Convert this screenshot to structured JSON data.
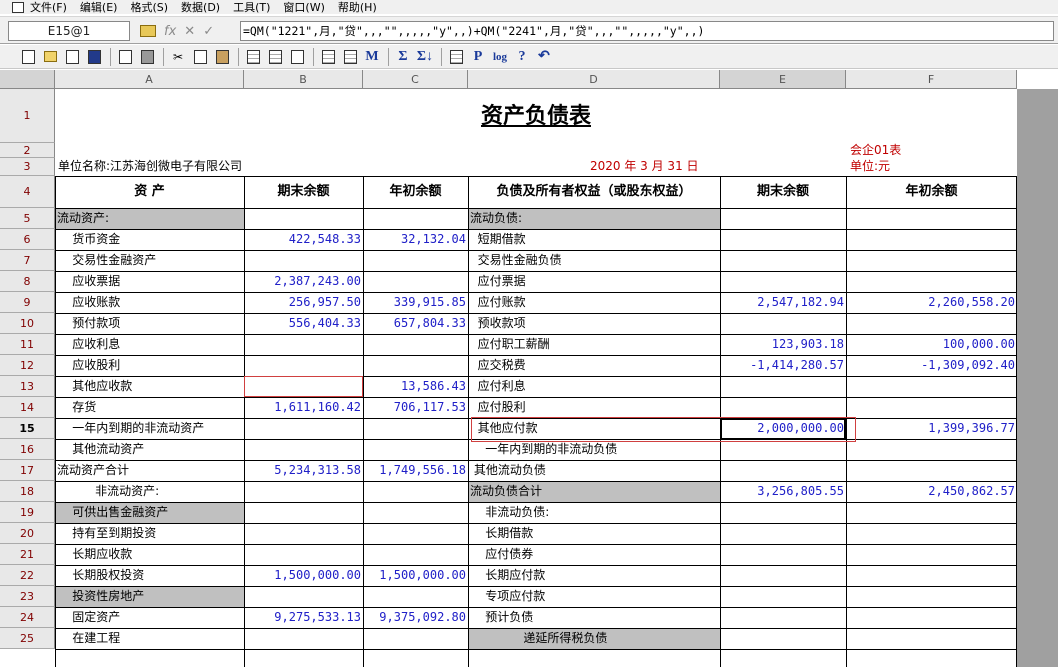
{
  "menu": [
    "文件(F)",
    "编辑(E)",
    "格式(S)",
    "数据(D)",
    "工具(T)",
    "窗口(W)",
    "帮助(H)"
  ],
  "formula_bar": {
    "cell_ref": "E15@1",
    "fx": "fx",
    "cancel": "✕",
    "confirm": "✓",
    "formula": "=QM(\"1221\",月,\"贷\",,,\"\",,,,,\"y\",,)+QM(\"2241\",月,\"贷\",,,\"\",,,,,\"y\",,)"
  },
  "toolbar": {
    "sum1": "Σ",
    "sum2": "Σ↓",
    "p": "P",
    "log": "log",
    "help": "?",
    "undo": "↶",
    "find": "M"
  },
  "columns": [
    "A",
    "B",
    "C",
    "D",
    "E",
    "F"
  ],
  "rows": [
    "1",
    "2",
    "3",
    "4",
    "5",
    "6",
    "7",
    "8",
    "9",
    "10",
    "11",
    "12",
    "13",
    "14",
    "15",
    "16",
    "17",
    "18",
    "19",
    "20",
    "21",
    "22",
    "23",
    "24",
    "25"
  ],
  "report": {
    "title": "资产负债表",
    "code": "会企01表",
    "unit_name": "单位名称:江苏海创微电子有限公司",
    "date": "2020 年   3 月 31 日",
    "unit": "单位:元",
    "headers": {
      "asset": "资        产",
      "end_balance": "期末余额",
      "begin_balance": "年初余额",
      "liability": "负债及所有者权益（或股东权益）",
      "end_balance2": "期末余额",
      "begin_balance2": "年初余额"
    }
  },
  "lines": [
    {
      "a": "流动资产:",
      "b": "",
      "c": "",
      "d": "流动负债:",
      "e": "",
      "f": "",
      "ga": true,
      "gd": true
    },
    {
      "a": "    货币资金",
      "b": "422,548.33",
      "c": "32,132.04",
      "d": "  短期借款",
      "e": "",
      "f": ""
    },
    {
      "a": "    交易性金融资产",
      "b": "",
      "c": "",
      "d": "  交易性金融负债",
      "e": "",
      "f": ""
    },
    {
      "a": "    应收票据",
      "b": "2,387,243.00",
      "c": "",
      "d": "  应付票据",
      "e": "",
      "f": ""
    },
    {
      "a": "    应收账款",
      "b": "256,957.50",
      "c": "339,915.85",
      "d": "  应付账款",
      "e": "2,547,182.94",
      "f": "2,260,558.20"
    },
    {
      "a": "    预付款项",
      "b": "556,404.33",
      "c": "657,804.33",
      "d": "  预收款项",
      "e": "",
      "f": ""
    },
    {
      "a": "    应收利息",
      "b": "",
      "c": "",
      "d": "  应付职工薪酬",
      "e": "123,903.18",
      "f": "100,000.00"
    },
    {
      "a": "    应收股利",
      "b": "",
      "c": "",
      "d": "  应交税费",
      "e": "-1,414,280.57",
      "f": "-1,309,092.40"
    },
    {
      "a": "    其他应收款",
      "b": "",
      "c": "13,586.43",
      "d": "  应付利息",
      "e": "",
      "f": ""
    },
    {
      "a": "    存货",
      "b": "1,611,160.42",
      "c": "706,117.53",
      "d": "  应付股利",
      "e": "",
      "f": ""
    },
    {
      "a": "    一年内到期的非流动资产",
      "b": "",
      "c": "",
      "d": "  其他应付款",
      "e": "2,000,000.00",
      "f": "1,399,396.77"
    },
    {
      "a": "    其他流动资产",
      "b": "",
      "c": "",
      "d": "    一年内到期的非流动负债",
      "e": "",
      "f": ""
    },
    {
      "a": "流动资产合计",
      "b": "5,234,313.58",
      "c": "1,749,556.18",
      "d": " 其他流动负债",
      "e": "",
      "f": ""
    },
    {
      "a": "          非流动资产:",
      "b": "",
      "c": "",
      "d": "流动负债合计",
      "e": "3,256,805.55",
      "f": "2,450,862.57",
      "gd": true
    },
    {
      "a": "    可供出售金融资产",
      "b": "",
      "c": "",
      "d": "    非流动负债:",
      "e": "",
      "f": "",
      "ga": true
    },
    {
      "a": "    持有至到期投资",
      "b": "",
      "c": "",
      "d": "    长期借款",
      "e": "",
      "f": ""
    },
    {
      "a": "    长期应收款",
      "b": "",
      "c": "",
      "d": "    应付债券",
      "e": "",
      "f": ""
    },
    {
      "a": "    长期股权投资",
      "b": "1,500,000.00",
      "c": "1,500,000.00",
      "d": "    长期应付款",
      "e": "",
      "f": ""
    },
    {
      "a": "    投资性房地产",
      "b": "",
      "c": "",
      "d": "    专项应付款",
      "e": "",
      "f": "",
      "ga": true
    },
    {
      "a": "    固定资产",
      "b": "9,275,533.13",
      "c": "9,375,092.80",
      "d": "    预计负债",
      "e": "",
      "f": ""
    },
    {
      "a": "    在建工程",
      "b": "",
      "c": "",
      "d": "              递延所得税负债",
      "e": "",
      "f": "",
      "gd": true
    }
  ]
}
